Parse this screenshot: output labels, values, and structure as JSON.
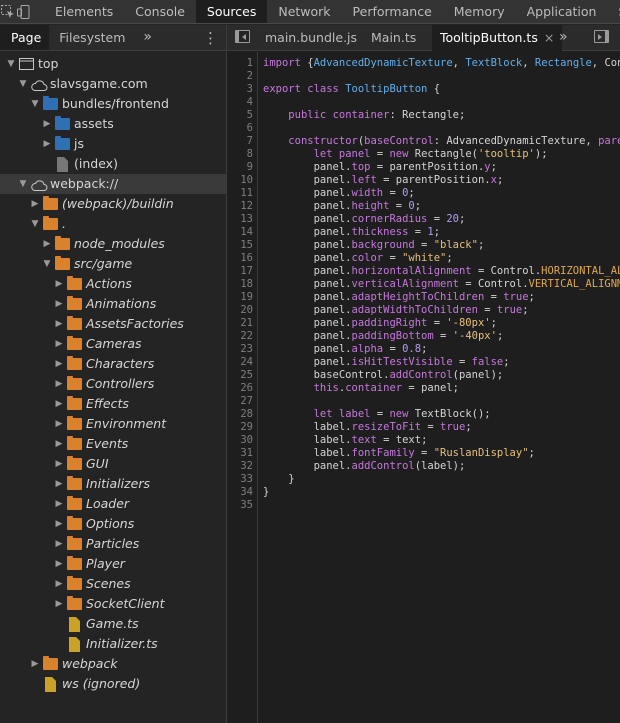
{
  "topbar": {
    "tabs": [
      {
        "label": "Elements",
        "active": false
      },
      {
        "label": "Console",
        "active": false
      },
      {
        "label": "Sources",
        "active": true
      },
      {
        "label": "Network",
        "active": false
      },
      {
        "label": "Performance",
        "active": false
      },
      {
        "label": "Memory",
        "active": false
      },
      {
        "label": "Application",
        "active": false
      },
      {
        "label": "Se",
        "active": false
      }
    ]
  },
  "navigator": {
    "tabs": [
      {
        "label": "Page",
        "active": true
      },
      {
        "label": "Filesystem",
        "active": false
      }
    ],
    "more": "»",
    "kebab": "⋮",
    "tree": [
      {
        "label": "top",
        "depth": 0,
        "arrow": "down",
        "icon": "frame",
        "italic": false,
        "selected": false
      },
      {
        "label": "slavsgame.com",
        "depth": 1,
        "arrow": "down",
        "icon": "cloud",
        "italic": false,
        "selected": false
      },
      {
        "label": "bundles/frontend",
        "depth": 2,
        "arrow": "down",
        "icon": "folder-blue",
        "italic": false,
        "selected": false
      },
      {
        "label": "assets",
        "depth": 3,
        "arrow": "right",
        "icon": "folder-blue",
        "italic": false,
        "selected": false
      },
      {
        "label": "js",
        "depth": 3,
        "arrow": "right",
        "icon": "folder-blue",
        "italic": false,
        "selected": false
      },
      {
        "label": "(index)",
        "depth": 3,
        "arrow": "none",
        "icon": "file-grey",
        "italic": false,
        "selected": false
      },
      {
        "label": "webpack://",
        "depth": 1,
        "arrow": "down",
        "icon": "cloud",
        "italic": false,
        "selected": true
      },
      {
        "label": "(webpack)/buildin",
        "depth": 2,
        "arrow": "right",
        "icon": "folder-orange",
        "italic": true,
        "selected": false
      },
      {
        "label": ".",
        "depth": 2,
        "arrow": "down",
        "icon": "folder-orange",
        "italic": true,
        "selected": false
      },
      {
        "label": "node_modules",
        "depth": 3,
        "arrow": "right",
        "icon": "folder-orange",
        "italic": true,
        "selected": false
      },
      {
        "label": "src/game",
        "depth": 3,
        "arrow": "down",
        "icon": "folder-orange",
        "italic": true,
        "selected": false
      },
      {
        "label": "Actions",
        "depth": 4,
        "arrow": "right",
        "icon": "folder-orange",
        "italic": true,
        "selected": false
      },
      {
        "label": "Animations",
        "depth": 4,
        "arrow": "right",
        "icon": "folder-orange",
        "italic": true,
        "selected": false
      },
      {
        "label": "AssetsFactories",
        "depth": 4,
        "arrow": "right",
        "icon": "folder-orange",
        "italic": true,
        "selected": false
      },
      {
        "label": "Cameras",
        "depth": 4,
        "arrow": "right",
        "icon": "folder-orange",
        "italic": true,
        "selected": false
      },
      {
        "label": "Characters",
        "depth": 4,
        "arrow": "right",
        "icon": "folder-orange",
        "italic": true,
        "selected": false
      },
      {
        "label": "Controllers",
        "depth": 4,
        "arrow": "right",
        "icon": "folder-orange",
        "italic": true,
        "selected": false
      },
      {
        "label": "Effects",
        "depth": 4,
        "arrow": "right",
        "icon": "folder-orange",
        "italic": true,
        "selected": false
      },
      {
        "label": "Environment",
        "depth": 4,
        "arrow": "right",
        "icon": "folder-orange",
        "italic": true,
        "selected": false
      },
      {
        "label": "Events",
        "depth": 4,
        "arrow": "right",
        "icon": "folder-orange",
        "italic": true,
        "selected": false
      },
      {
        "label": "GUI",
        "depth": 4,
        "arrow": "right",
        "icon": "folder-orange",
        "italic": true,
        "selected": false
      },
      {
        "label": "Initializers",
        "depth": 4,
        "arrow": "right",
        "icon": "folder-orange",
        "italic": true,
        "selected": false
      },
      {
        "label": "Loader",
        "depth": 4,
        "arrow": "right",
        "icon": "folder-orange",
        "italic": true,
        "selected": false
      },
      {
        "label": "Options",
        "depth": 4,
        "arrow": "right",
        "icon": "folder-orange",
        "italic": true,
        "selected": false
      },
      {
        "label": "Particles",
        "depth": 4,
        "arrow": "right",
        "icon": "folder-orange",
        "italic": true,
        "selected": false
      },
      {
        "label": "Player",
        "depth": 4,
        "arrow": "right",
        "icon": "folder-orange",
        "italic": true,
        "selected": false
      },
      {
        "label": "Scenes",
        "depth": 4,
        "arrow": "right",
        "icon": "folder-orange",
        "italic": true,
        "selected": false
      },
      {
        "label": "SocketClient",
        "depth": 4,
        "arrow": "right",
        "icon": "folder-orange",
        "italic": true,
        "selected": false
      },
      {
        "label": "Game.ts",
        "depth": 4,
        "arrow": "none",
        "icon": "file-yellow",
        "italic": true,
        "selected": false
      },
      {
        "label": "Initializer.ts",
        "depth": 4,
        "arrow": "none",
        "icon": "file-yellow",
        "italic": true,
        "selected": false
      },
      {
        "label": "webpack",
        "depth": 2,
        "arrow": "right",
        "icon": "folder-orange",
        "italic": true,
        "selected": false
      },
      {
        "label": "ws (ignored)",
        "depth": 2,
        "arrow": "none",
        "icon": "file-yellow",
        "italic": true,
        "selected": false
      }
    ]
  },
  "editor": {
    "tabs": [
      {
        "label": "main.bundle.js",
        "active": false
      },
      {
        "label": "Main.ts",
        "active": false
      },
      {
        "label": "TooltipButton.ts",
        "active": true,
        "close": "×"
      }
    ],
    "more": "»",
    "lines": [
      [
        [
          "kw",
          "import"
        ],
        [
          "pl",
          " {"
        ],
        [
          "typ",
          "AdvancedDynamicTexture"
        ],
        [
          "pl",
          ", "
        ],
        [
          "typ",
          "TextBlock"
        ],
        [
          "pl",
          ", "
        ],
        [
          "typ",
          "Rectangle"
        ],
        [
          "pl",
          ", Contro"
        ]
      ],
      [],
      [
        [
          "kw",
          "export"
        ],
        [
          "pl",
          " "
        ],
        [
          "kw",
          "class"
        ],
        [
          "pl",
          " "
        ],
        [
          "typ",
          "TooltipButton"
        ],
        [
          "pl",
          " {"
        ]
      ],
      [],
      [
        [
          "pl",
          "    "
        ],
        [
          "kw",
          "public"
        ],
        [
          "pl",
          " "
        ],
        [
          "prop",
          "container"
        ],
        [
          "pl",
          ": Rectangle;"
        ]
      ],
      [],
      [
        [
          "pl",
          "    "
        ],
        [
          "kw",
          "constructor"
        ],
        [
          "pl",
          "("
        ],
        [
          "prop",
          "baseControl"
        ],
        [
          "pl",
          ": AdvancedDynamicTexture, "
        ],
        [
          "prop",
          "parentPosition"
        ]
      ],
      [
        [
          "pl",
          "        "
        ],
        [
          "kw",
          "let"
        ],
        [
          "pl",
          " "
        ],
        [
          "prop",
          "panel"
        ],
        [
          "pl",
          " = "
        ],
        [
          "kw",
          "new"
        ],
        [
          "pl",
          " Rectangle("
        ],
        [
          "str",
          "'tooltip'"
        ],
        [
          "pl",
          ");"
        ]
      ],
      [
        [
          "pl",
          "        panel."
        ],
        [
          "prop",
          "top"
        ],
        [
          "pl",
          " = parentPosition."
        ],
        [
          "prop",
          "y"
        ],
        [
          "pl",
          ";"
        ]
      ],
      [
        [
          "pl",
          "        panel."
        ],
        [
          "prop",
          "left"
        ],
        [
          "pl",
          " = parentPosition."
        ],
        [
          "prop",
          "x"
        ],
        [
          "pl",
          ";"
        ]
      ],
      [
        [
          "pl",
          "        panel."
        ],
        [
          "prop",
          "width"
        ],
        [
          "pl",
          " = "
        ],
        [
          "num",
          "0"
        ],
        [
          "pl",
          ";"
        ]
      ],
      [
        [
          "pl",
          "        panel."
        ],
        [
          "prop",
          "height"
        ],
        [
          "pl",
          " = "
        ],
        [
          "num",
          "0"
        ],
        [
          "pl",
          ";"
        ]
      ],
      [
        [
          "pl",
          "        panel."
        ],
        [
          "prop",
          "cornerRadius"
        ],
        [
          "pl",
          " = "
        ],
        [
          "num",
          "20"
        ],
        [
          "pl",
          ";"
        ]
      ],
      [
        [
          "pl",
          "        panel."
        ],
        [
          "prop",
          "thickness"
        ],
        [
          "pl",
          " = "
        ],
        [
          "num",
          "1"
        ],
        [
          "pl",
          ";"
        ]
      ],
      [
        [
          "pl",
          "        panel."
        ],
        [
          "prop",
          "background"
        ],
        [
          "pl",
          " = "
        ],
        [
          "str",
          "\"black\""
        ],
        [
          "pl",
          ";"
        ]
      ],
      [
        [
          "pl",
          "        panel."
        ],
        [
          "prop",
          "color"
        ],
        [
          "pl",
          " = "
        ],
        [
          "str",
          "\"white\""
        ],
        [
          "pl",
          ";"
        ]
      ],
      [
        [
          "pl",
          "        panel."
        ],
        [
          "prop",
          "horizontalAlignment"
        ],
        [
          "pl",
          " = Control."
        ],
        [
          "cls",
          "HORIZONTAL_ALIGNMENT_LEF"
        ]
      ],
      [
        [
          "pl",
          "        panel."
        ],
        [
          "prop",
          "verticalAlignment"
        ],
        [
          "pl",
          " = Control."
        ],
        [
          "cls",
          "VERTICAL_ALIGNMENT_TOP;"
        ]
      ],
      [
        [
          "pl",
          "        panel."
        ],
        [
          "prop",
          "adaptHeightToChildren"
        ],
        [
          "pl",
          " = "
        ],
        [
          "kw",
          "true"
        ],
        [
          "pl",
          ";"
        ]
      ],
      [
        [
          "pl",
          "        panel."
        ],
        [
          "prop",
          "adaptWidthToChildren"
        ],
        [
          "pl",
          " = "
        ],
        [
          "kw",
          "true"
        ],
        [
          "pl",
          ";"
        ]
      ],
      [
        [
          "pl",
          "        panel."
        ],
        [
          "prop",
          "paddingRight"
        ],
        [
          "pl",
          " = "
        ],
        [
          "str",
          "'-80px'"
        ],
        [
          "pl",
          ";"
        ]
      ],
      [
        [
          "pl",
          "        panel."
        ],
        [
          "prop",
          "paddingBottom"
        ],
        [
          "pl",
          " = "
        ],
        [
          "str",
          "'-40px'"
        ],
        [
          "pl",
          ";"
        ]
      ],
      [
        [
          "pl",
          "        panel."
        ],
        [
          "prop",
          "alpha"
        ],
        [
          "pl",
          " = "
        ],
        [
          "num",
          "0.8"
        ],
        [
          "pl",
          ";"
        ]
      ],
      [
        [
          "pl",
          "        panel."
        ],
        [
          "prop",
          "isHitTestVisible"
        ],
        [
          "pl",
          " = "
        ],
        [
          "kw",
          "false"
        ],
        [
          "pl",
          ";"
        ]
      ],
      [
        [
          "pl",
          "        baseControl."
        ],
        [
          "prop",
          "addControl"
        ],
        [
          "pl",
          "(panel);"
        ]
      ],
      [
        [
          "pl",
          "        "
        ],
        [
          "kw",
          "this"
        ],
        [
          "pl",
          "."
        ],
        [
          "prop",
          "container"
        ],
        [
          "pl",
          " = panel;"
        ]
      ],
      [],
      [
        [
          "pl",
          "        "
        ],
        [
          "kw",
          "let"
        ],
        [
          "pl",
          " "
        ],
        [
          "prop",
          "label"
        ],
        [
          "pl",
          " = "
        ],
        [
          "kw",
          "new"
        ],
        [
          "pl",
          " TextBlock();"
        ]
      ],
      [
        [
          "pl",
          "        label."
        ],
        [
          "prop",
          "resizeToFit"
        ],
        [
          "pl",
          " = "
        ],
        [
          "kw",
          "true"
        ],
        [
          "pl",
          ";"
        ]
      ],
      [
        [
          "pl",
          "        label."
        ],
        [
          "prop",
          "text"
        ],
        [
          "pl",
          " = text;"
        ]
      ],
      [
        [
          "pl",
          "        label."
        ],
        [
          "prop",
          "fontFamily"
        ],
        [
          "pl",
          " = "
        ],
        [
          "str",
          "\"RuslanDisplay\""
        ],
        [
          "pl",
          ";"
        ]
      ],
      [
        [
          "pl",
          "        panel."
        ],
        [
          "prop",
          "addControl"
        ],
        [
          "pl",
          "(label);"
        ]
      ],
      [
        [
          "pl",
          "    }"
        ]
      ],
      [
        [
          "pl",
          "}"
        ]
      ],
      []
    ]
  },
  "colors": {
    "accent_keyword": "#c678dd",
    "type": "#61afef",
    "string": "#e5c07b",
    "number": "#b49bf5",
    "folder_orange": "#d9822b",
    "folder_blue": "#2f6fb3"
  }
}
